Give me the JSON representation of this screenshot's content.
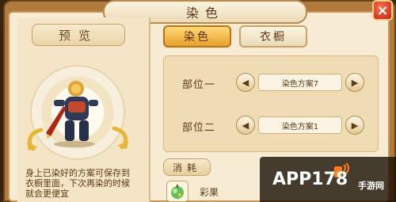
{
  "window": {
    "title": "染色",
    "close_icon": "×"
  },
  "preview": {
    "label": "预览",
    "description": "身上已染好的方案可保存到衣橱里面，下次再染的时候就会更便宜"
  },
  "tabs": {
    "dye": "染色",
    "wardrobe": "衣橱"
  },
  "parts": [
    {
      "label": "部位一",
      "scheme": "染色方案7"
    },
    {
      "label": "部位二",
      "scheme": "染色方案1"
    }
  ],
  "consume": {
    "label": "消耗",
    "item_name": "彩果"
  },
  "watermark": {
    "brand": "APP178",
    "sub": "手游网"
  },
  "colors": {
    "accent": "#e7a02d",
    "panel": "#f7ecd3",
    "close": "#c2230e"
  }
}
